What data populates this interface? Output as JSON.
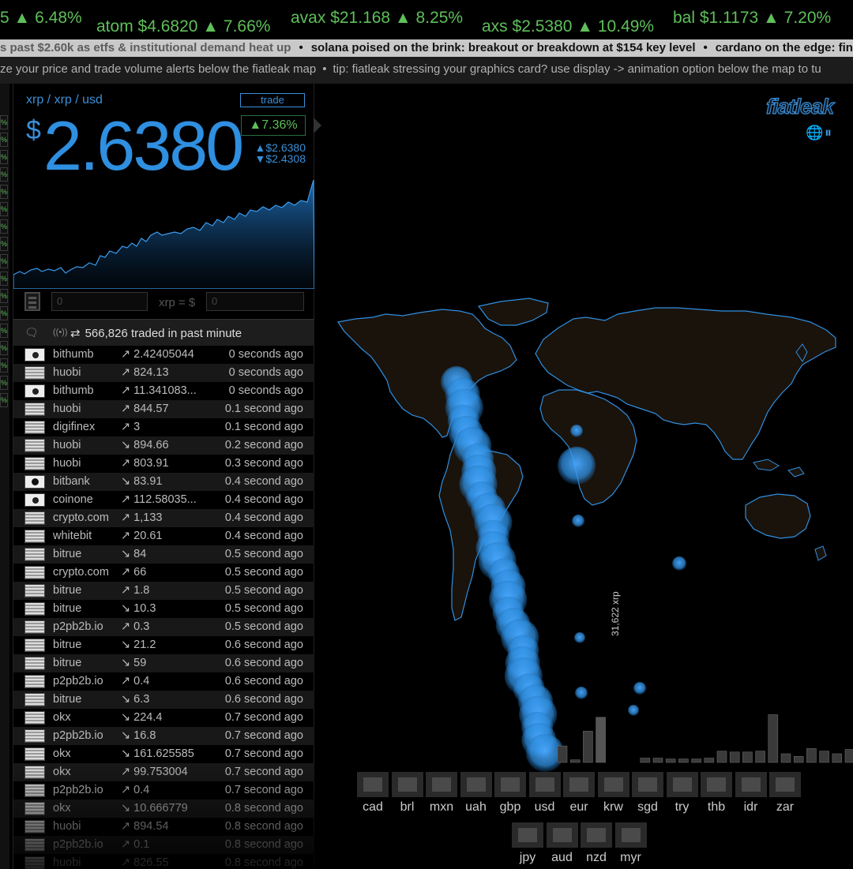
{
  "ticker": [
    {
      "text": "5 ▲ 6.48%"
    },
    {
      "text": "atom $4.6820 ▲ 7.66%"
    },
    {
      "text": "avax $21.168 ▲ 8.25%"
    },
    {
      "text": "axs $2.5380 ▲ 10.49%"
    },
    {
      "text": "bal $1.1173 ▲ 7.20%"
    }
  ],
  "news": {
    "items": [
      "s past $2.60k as etfs & institutional demand heat up",
      "solana poised on the brink: breakout or breakdown at $154 key level",
      "cardano on the edge: fina"
    ],
    "separator": "•"
  },
  "tip": {
    "items": [
      "ze your price and trade volume alerts below the fiatleak map",
      "tip: fiatleak stressing your graphics card? use display -> animation option below the map to tu"
    ],
    "separator": "•"
  },
  "strip_cells": [
    "%",
    "%",
    "%",
    "%",
    "%",
    "%",
    "%",
    "%",
    "%",
    "%",
    "%",
    "%",
    "%",
    "%",
    "%",
    "%",
    "%"
  ],
  "panel": {
    "pair": "xrp / xrp / usd",
    "trade_label": "trade",
    "currency_symbol": "$",
    "price": "2.6380",
    "change": "▲7.36%",
    "high": "▲$2.6380",
    "low": "▼$2.4308",
    "calc_left": "0",
    "calc_label": "xrp = $",
    "calc_right": "0",
    "traded_text": "566,826  traded in past minute",
    "traded_icon": "⇄",
    "chat_icon": "🗨",
    "radio_icon": "((•))"
  },
  "trades": [
    {
      "flag": "kr",
      "exchange": "bithumb",
      "dir": "↗",
      "amount": "2.42405044",
      "ago": "0 seconds ago"
    },
    {
      "flag": "us",
      "exchange": "huobi",
      "dir": "↗",
      "amount": "824.13",
      "ago": "0 seconds ago"
    },
    {
      "flag": "kr",
      "exchange": "bithumb",
      "dir": "↗",
      "amount": "11.341083...",
      "ago": "0 seconds ago"
    },
    {
      "flag": "us",
      "exchange": "huobi",
      "dir": "↗",
      "amount": "844.57",
      "ago": "0.1 second ago"
    },
    {
      "flag": "us",
      "exchange": "digifinex",
      "dir": "↗",
      "amount": "3",
      "ago": "0.1 second ago"
    },
    {
      "flag": "us",
      "exchange": "huobi",
      "dir": "↘",
      "amount": "894.66",
      "ago": "0.2 second ago"
    },
    {
      "flag": "us",
      "exchange": "huobi",
      "dir": "↗",
      "amount": "803.91",
      "ago": "0.3 second ago"
    },
    {
      "flag": "jp",
      "exchange": "bitbank",
      "dir": "↘",
      "amount": "83.91",
      "ago": "0.4 second ago"
    },
    {
      "flag": "kr",
      "exchange": "coinone",
      "dir": "↗",
      "amount": "112.58035...",
      "ago": "0.4 second ago"
    },
    {
      "flag": "us",
      "exchange": "crypto.com",
      "dir": "↗",
      "amount": "1,133",
      "ago": "0.4 second ago"
    },
    {
      "flag": "us",
      "exchange": "whitebit",
      "dir": "↗",
      "amount": "20.61",
      "ago": "0.4 second ago"
    },
    {
      "flag": "us",
      "exchange": "bitrue",
      "dir": "↘",
      "amount": "84",
      "ago": "0.5 second ago"
    },
    {
      "flag": "us",
      "exchange": "crypto.com",
      "dir": "↗",
      "amount": "66",
      "ago": "0.5 second ago"
    },
    {
      "flag": "us",
      "exchange": "bitrue",
      "dir": "↗",
      "amount": "1.8",
      "ago": "0.5 second ago"
    },
    {
      "flag": "us",
      "exchange": "bitrue",
      "dir": "↘",
      "amount": "10.3",
      "ago": "0.5 second ago"
    },
    {
      "flag": "us",
      "exchange": "p2pb2b.io",
      "dir": "↗",
      "amount": "0.3",
      "ago": "0.5 second ago"
    },
    {
      "flag": "us",
      "exchange": "bitrue",
      "dir": "↘",
      "amount": "21.2",
      "ago": "0.6 second ago"
    },
    {
      "flag": "us",
      "exchange": "bitrue",
      "dir": "↘",
      "amount": "59",
      "ago": "0.6 second ago"
    },
    {
      "flag": "us",
      "exchange": "p2pb2b.io",
      "dir": "↗",
      "amount": "0.4",
      "ago": "0.6 second ago"
    },
    {
      "flag": "us",
      "exchange": "bitrue",
      "dir": "↘",
      "amount": "6.3",
      "ago": "0.6 second ago"
    },
    {
      "flag": "us",
      "exchange": "okx",
      "dir": "↘",
      "amount": "224.4",
      "ago": "0.7 second ago"
    },
    {
      "flag": "us",
      "exchange": "p2pb2b.io",
      "dir": "↘",
      "amount": "16.8",
      "ago": "0.7 second ago"
    },
    {
      "flag": "us",
      "exchange": "okx",
      "dir": "↘",
      "amount": "161.625585",
      "ago": "0.7 second ago"
    },
    {
      "flag": "us",
      "exchange": "okx",
      "dir": "↗",
      "amount": "99.753004",
      "ago": "0.7 second ago"
    },
    {
      "flag": "us",
      "exchange": "p2pb2b.io",
      "dir": "↗",
      "amount": "0.4",
      "ago": "0.7 second ago"
    },
    {
      "flag": "us",
      "exchange": "okx",
      "dir": "↘",
      "amount": "10.666779",
      "ago": "0.8 second ago"
    },
    {
      "flag": "us",
      "exchange": "huobi",
      "dir": "↗",
      "amount": "894.54",
      "ago": "0.8 second ago"
    },
    {
      "flag": "us",
      "exchange": "p2pb2b.io",
      "dir": "↗",
      "amount": "0.1",
      "ago": "0.8 second ago"
    },
    {
      "flag": "us",
      "exchange": "huobi",
      "dir": "↗",
      "amount": "826.55",
      "ago": "0.8 second ago"
    }
  ],
  "map": {
    "logo": "fiatleak",
    "globe_icon": "🌐",
    "pause_icon": "⏸",
    "volume_label": "31,622 xrp",
    "currencies_row1": [
      "cad",
      "brl",
      "mxn",
      "uah",
      "gbp",
      "usd",
      "eur",
      "krw",
      "sgd",
      "try",
      "thb",
      "idr",
      "zar"
    ],
    "currencies_row2": [
      "jpy",
      "aud",
      "nzd",
      "myr"
    ],
    "volume_levels": [
      0.19,
      0.03,
      0.36,
      0.52,
      0.05,
      0.05,
      0.04,
      0.04,
      0.04,
      0.05,
      0.13,
      0.12,
      0.12,
      0.13,
      0.55,
      0.1,
      0.07,
      0.16,
      0.13,
      0.1,
      0.15,
      0.12
    ],
    "accent": "#2f8fe0",
    "land": "#1a130c"
  },
  "colors": {
    "accent_blue": "#2f8fe0",
    "green": "#5fbf5a",
    "background": "#000000"
  }
}
